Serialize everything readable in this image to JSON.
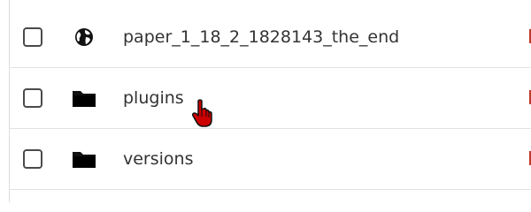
{
  "files": [
    {
      "name": "paper_1_18_2_1828143_the_end",
      "icon": "globe-icon",
      "checked": false
    },
    {
      "name": "plugins",
      "icon": "folder-icon",
      "checked": false
    },
    {
      "name": "versions",
      "icon": "folder-icon",
      "checked": false
    }
  ],
  "colors": {
    "text": "#333333",
    "divider": "#e2e2e2",
    "accent": "#c0392b",
    "cursor": "#cc0000"
  }
}
